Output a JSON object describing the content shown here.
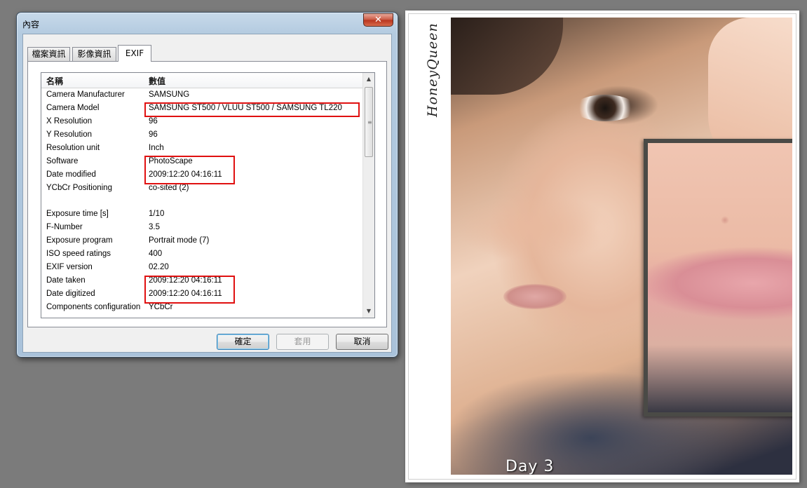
{
  "window": {
    "title": "內容",
    "close_glyph": "✕"
  },
  "tabs": [
    {
      "label": "檔案資訊"
    },
    {
      "label": "影像資訊"
    },
    {
      "label": "EXIF"
    }
  ],
  "exif_list": {
    "columns": {
      "name": "名稱",
      "value": "數值"
    },
    "rows": [
      {
        "name": "Camera Manufacturer",
        "value": "SAMSUNG"
      },
      {
        "name": "Camera Model",
        "value": "SAMSUNG ST500 / VLUU ST500 / SAMSUNG TL220"
      },
      {
        "name": "X Resolution",
        "value": "96"
      },
      {
        "name": "Y Resolution",
        "value": "96"
      },
      {
        "name": "Resolution unit",
        "value": "Inch"
      },
      {
        "name": "Software",
        "value": "PhotoScape"
      },
      {
        "name": "Date modified",
        "value": "2009:12:20 04:16:11"
      },
      {
        "name": "YCbCr Positioning",
        "value": "co-sited (2)"
      },
      {
        "name": "",
        "value": ""
      },
      {
        "name": "Exposure time [s]",
        "value": "1/10"
      },
      {
        "name": "F-Number",
        "value": "3.5"
      },
      {
        "name": "Exposure program",
        "value": "Portrait mode (7)"
      },
      {
        "name": "ISO speed ratings",
        "value": "400"
      },
      {
        "name": "EXIF version",
        "value": "02.20"
      },
      {
        "name": "Date taken",
        "value": "2009:12:20 04:16:11"
      },
      {
        "name": "Date digitized",
        "value": "2009:12:20 04:16:11"
      },
      {
        "name": "Components configuration",
        "value": "YCbCr"
      }
    ]
  },
  "buttons": {
    "ok": "確定",
    "apply": "套用",
    "cancel": "取消"
  },
  "photo": {
    "watermark": "HoneyQueen",
    "caption": "Day 3"
  },
  "colors": {
    "highlight_box": "#e01010",
    "desktop_bg": "#7b7b7b"
  }
}
